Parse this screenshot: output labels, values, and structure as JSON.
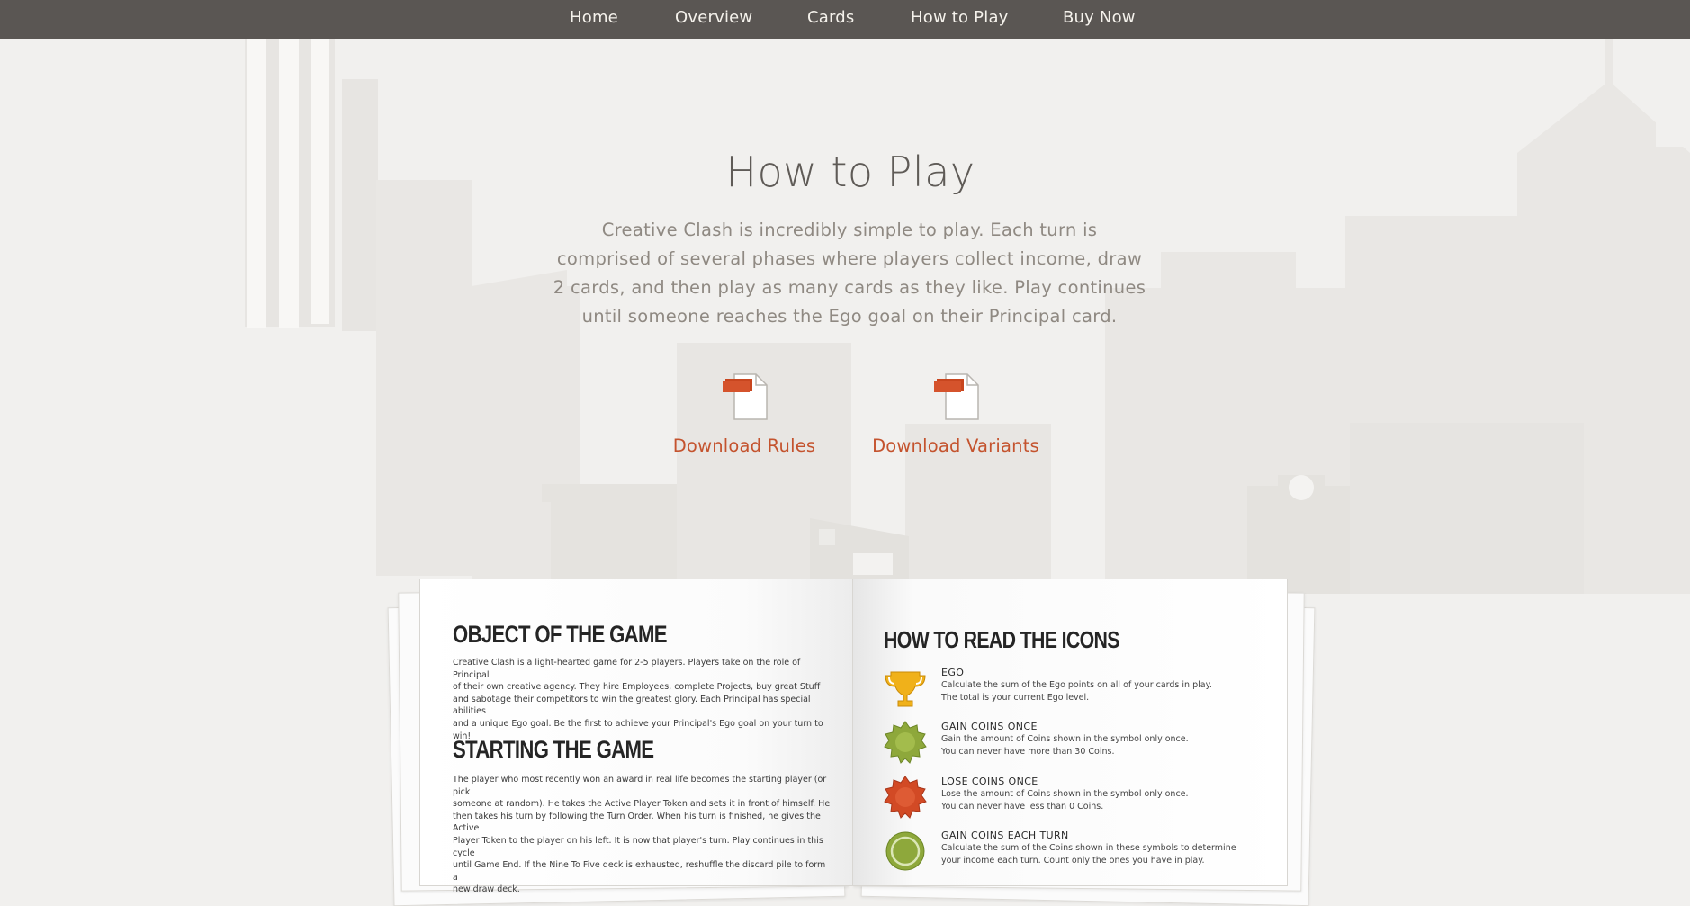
{
  "nav": {
    "links": [
      "Home",
      "Overview",
      "Cards",
      "How to Play",
      "Buy Now"
    ],
    "background": "#5a5653",
    "text_color": "#f5f2ec"
  },
  "hero": {
    "title": "How to Play",
    "description_lines": [
      "Creative Clash is incredibly simple to play. Each turn is",
      "comprised of several phases where players collect income, draw",
      "2 cards, and then play as many cards as they like. Play continues",
      "until someone reaches the Ego goal on their Principal card."
    ]
  },
  "downloads": {
    "rules_label": "Download Rules",
    "variants_label": "Download Variants",
    "accent": "#c4532e",
    "icon": "document-icon"
  },
  "book": {
    "left_page": {
      "heading_1": "OBJECT OF THE GAME",
      "paragraph_1_lines": [
        "Creative Clash is a light-hearted game for 2-5 players. Players take on the role of Principal",
        "of their own creative agency. They hire Employees, complete Projects, buy great Stuff",
        "and sabotage their competitors to win the greatest glory. Each Principal has special abilities",
        "and a unique Ego goal. Be the first to achieve your Principal's Ego goal on your turn to win!"
      ],
      "heading_2": "STARTING THE GAME",
      "paragraph_2_lines": [
        "The player who most recently won an award in real life becomes the starting player (or pick",
        "someone at random). He takes the Active Player Token and sets it in front of himself. He",
        "then takes his turn by following the Turn Order. When his turn is finished, he gives the Active",
        "Player Token to the player on his left. It is now that player's turn. Play continues in this cycle",
        "until Game End. If the Nine To Five deck is exhausted, reshuffle the discard pile to form a",
        "new draw deck."
      ]
    },
    "right_page": {
      "heading": "HOW TO READ THE ICONS",
      "icons": [
        {
          "icon": "trophy-icon",
          "label": "EGO",
          "desc_lines": [
            "Calculate the sum of the Ego points on all of your cards in play.",
            "The total is your current Ego level."
          ]
        },
        {
          "icon": "green-badge-icon",
          "label": "GAIN COINS ONCE",
          "desc_lines": [
            "Gain the amount of Coins shown in the symbol only once.",
            "You can never have more than 30 Coins."
          ]
        },
        {
          "icon": "red-badge-icon",
          "label": "LOSE COINS ONCE",
          "desc_lines": [
            "Lose the amount of Coins shown in the symbol only once.",
            "You can never have less than 0 Coins."
          ]
        },
        {
          "icon": "green-coin-icon",
          "label": "GAIN COINS EACH TURN",
          "desc_lines": [
            "Calculate the sum of the Coins shown in these symbols to determine",
            "your income each turn. Count only the ones you have in play."
          ]
        }
      ]
    }
  }
}
